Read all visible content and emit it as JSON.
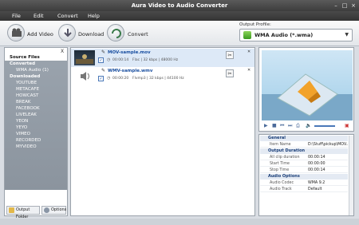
{
  "window": {
    "title": "Aura Video to Audio Converter"
  },
  "menu": [
    "File",
    "Edit",
    "Convert",
    "Help"
  ],
  "toolbar": {
    "add_video": "Add Video",
    "download": "Download",
    "convert": "Convert"
  },
  "output_profile": {
    "label": "Output Profile:",
    "value": "WMA Audio (*.wma)"
  },
  "left": {
    "close": "X",
    "tree": [
      "Source Files",
      "Converted",
      "WMA Audio (1)",
      "Downloaded",
      "YOUTUBE",
      "METACAFE",
      "HOWCAST",
      "BREAK",
      "FACEBOOK",
      "LIVELEAK",
      "YEON",
      "YEYO",
      "VIMEO",
      "RECORDED",
      "MYVIDEO"
    ],
    "output_folder": "Output Folder",
    "options": "Options"
  },
  "files": [
    {
      "name": "MOV-sample.mov",
      "time": "00:00:14",
      "info": "Flac | 32 kbps | 48000 Hz",
      "check": "✓"
    },
    {
      "name": "WMV-sample.wmv",
      "time": "00:00:20",
      "info": "Flvmp3 | 32 kbps | 44100 Hz",
      "check": "✓"
    }
  ],
  "props": {
    "general": "General",
    "item_name_k": "Item Name",
    "item_name_v": "D:\\Stuff\\pickup\\MOV...",
    "output_duration": "Output Duration",
    "all_clip_k": "All clip duration",
    "all_clip_v": "00:00:14",
    "start_k": "Start Time",
    "start_v": "00:00:00",
    "stop_k": "Stop Time",
    "stop_v": "00:00:14",
    "audio_options": "Audio Options",
    "codec_k": "Audio Codec",
    "codec_v": "WMA 9.2",
    "track_k": "Audio Track",
    "track_v": "Default"
  },
  "colors": {
    "accent": "#1a4fa0",
    "selection": "#dde9f7",
    "tree_bg": "#8b949e"
  }
}
